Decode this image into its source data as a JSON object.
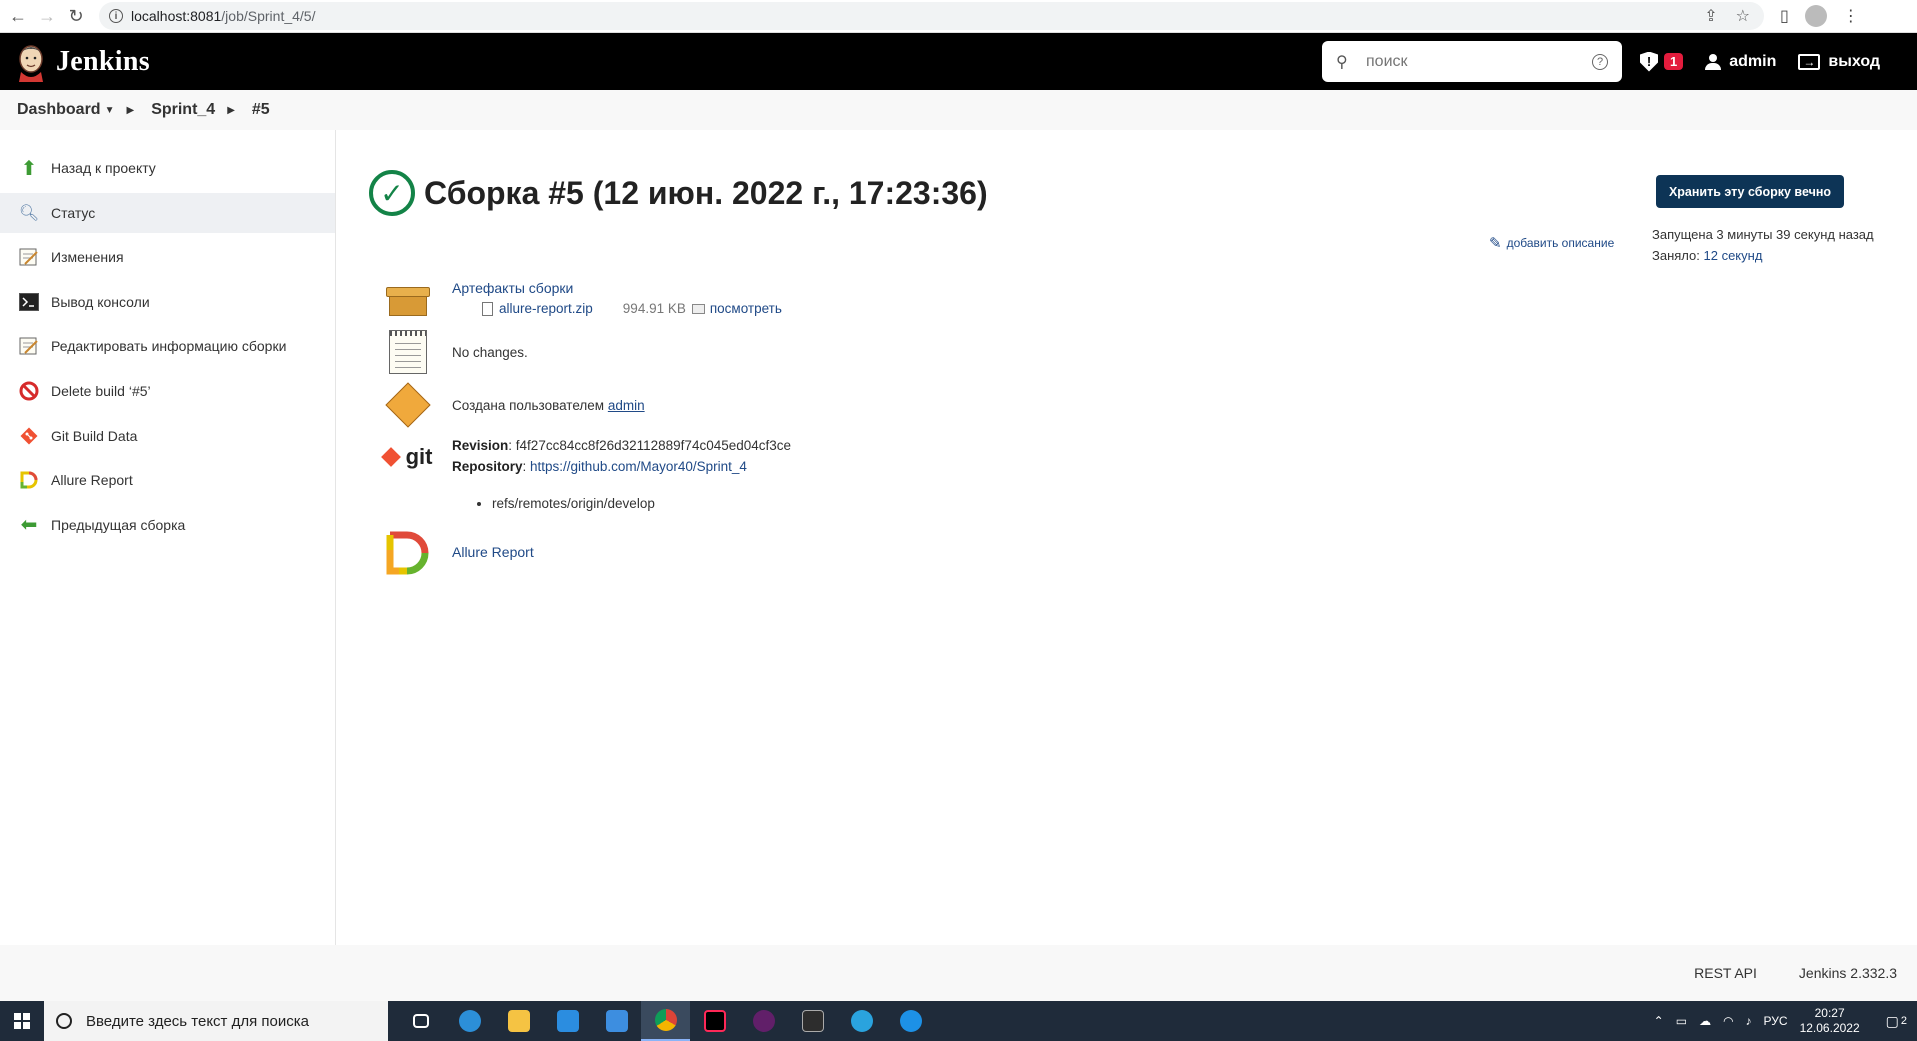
{
  "browser": {
    "url_host": "localhost:8081",
    "url_path": "/job/Sprint_4/5/"
  },
  "header": {
    "app_title": "Jenkins",
    "search_placeholder": "поиск",
    "alert_count": "1",
    "user": "admin",
    "logout": "выход"
  },
  "breadcrumbs": {
    "dashboard": "Dashboard",
    "job": "Sprint_4",
    "build": "#5"
  },
  "sidebar": {
    "items": [
      {
        "label": "Назад к проекту"
      },
      {
        "label": "Статус"
      },
      {
        "label": "Изменения"
      },
      {
        "label": "Вывод консоли"
      },
      {
        "label": "Редактировать информацию сборки"
      },
      {
        "label": "Delete build ‘#5’"
      },
      {
        "label": "Git Build Data"
      },
      {
        "label": "Allure Report"
      },
      {
        "label": "Предыдущая сборка"
      }
    ]
  },
  "main": {
    "title": "Сборка #5 (12 июн. 2022 г., 17:23:36)",
    "keep_button": "Хранить эту сборку вечно",
    "add_description": "добавить описание",
    "started": "Запущена 3 минуты 39 секунд назад",
    "took_label": "Заняло:",
    "took_value": "12 секунд",
    "artifacts_title": "Артефакты сборки",
    "artifact_file": "allure-report.zip",
    "artifact_size": "994.91 KB",
    "artifact_view": "посмотреть",
    "changes": "No changes.",
    "started_by_label": "Создана пользователем",
    "started_by_user": "admin",
    "revision_label": "Revision",
    "revision_value": "f4f27cc84cc8f26d32112889f74c045ed04cf3ce",
    "repository_label": "Repository",
    "repository_value": "https://github.com/Mayor40/Sprint_4",
    "branch": "refs/remotes/origin/develop",
    "allure_link": "Allure Report",
    "git_text": "git"
  },
  "footer": {
    "rest_api": "REST API",
    "version": "Jenkins 2.332.3"
  },
  "taskbar": {
    "search_placeholder": "Введите здесь текст для поиска",
    "lang": "РУС",
    "time": "20:27",
    "date": "12.06.2022",
    "notifications": "2"
  }
}
